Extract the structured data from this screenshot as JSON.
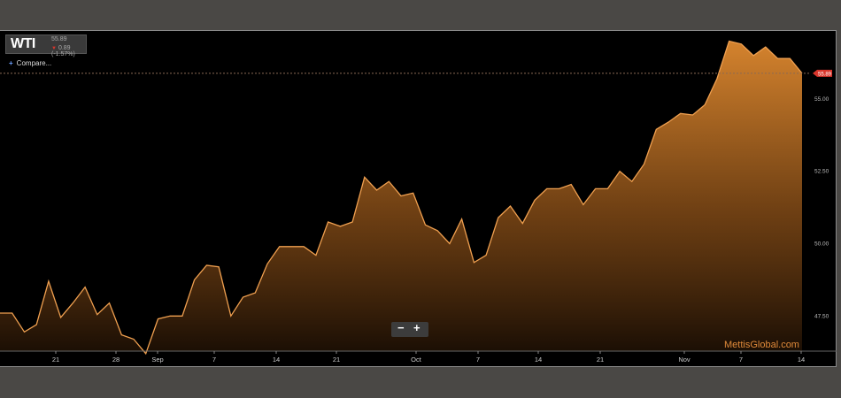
{
  "header": {
    "symbol": "WTI",
    "price": "55.89",
    "change": "0.89 (-1.57%)",
    "compare_label": "Compare...",
    "compare_icon": "plus-icon"
  },
  "controls": {
    "zoom_out_label": "−",
    "zoom_in_label": "+"
  },
  "watermark": "MettisGlobal.com",
  "colors": {
    "background": "#000000",
    "line": "#f0a050",
    "fill_top": "#e08a30",
    "fill_bottom": "#000000",
    "price_marker": "#d9362c",
    "watermark": "#e08a3a"
  },
  "chart_data": {
    "type": "area",
    "title": "",
    "xlabel": "",
    "ylabel": "",
    "ylim": [
      46.5,
      57.2
    ],
    "x_ticks": [
      "21",
      "28",
      "Sep",
      "7",
      "14",
      "21",
      "Oct",
      "7",
      "14",
      "21",
      "Nov",
      "7",
      "14"
    ],
    "y_ticks": [
      "47.50",
      "50.00",
      "52.50",
      "55.00"
    ],
    "last_price_label": "55.89",
    "series": [
      {
        "values": [
          47.6,
          47.6,
          46.95,
          47.2,
          48.7,
          47.45,
          47.95,
          48.5,
          47.55,
          47.95,
          46.85,
          46.7,
          46.2,
          47.4,
          47.5,
          47.5,
          48.75,
          49.25,
          49.2,
          47.5,
          48.15,
          48.3,
          49.3,
          49.9,
          49.9,
          49.9,
          49.6,
          50.75,
          50.6,
          50.75,
          52.3,
          51.85,
          52.15,
          51.65,
          51.75,
          50.65,
          50.45,
          50.0,
          50.85,
          49.35,
          49.6,
          50.9,
          51.3,
          50.7,
          51.5,
          51.9,
          51.9,
          52.05,
          51.35,
          51.9,
          51.9,
          52.5,
          52.15,
          52.75,
          53.95,
          54.2,
          54.5,
          54.45,
          54.8,
          55.7,
          57.0,
          56.9,
          56.5,
          56.8,
          56.4,
          56.4,
          55.89
        ]
      }
    ]
  }
}
